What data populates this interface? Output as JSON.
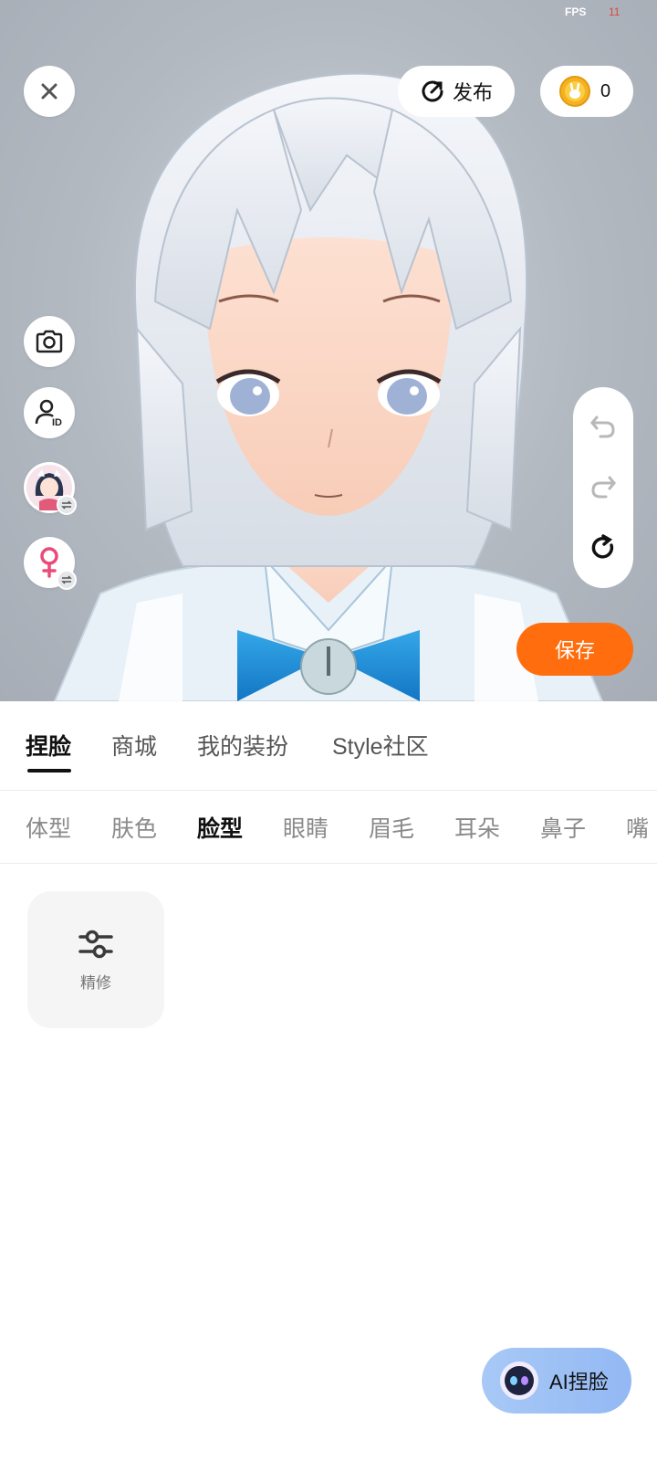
{
  "status": {
    "fps_label": "FPS",
    "fps_value": "11"
  },
  "top_bar": {
    "close_icon": "close-icon",
    "publish_label": "发布",
    "coin_count": "0"
  },
  "side_tools": [
    "camera-icon",
    "avatar-id-icon",
    "character-swap",
    "gender-female-icon"
  ],
  "undo_panel": [
    "undo-icon",
    "redo-icon",
    "reset-icon"
  ],
  "save_label": "保存",
  "main_tabs": [
    {
      "label": "捏脸",
      "active": true
    },
    {
      "label": "商城"
    },
    {
      "label": "我的装扮"
    },
    {
      "label": "Style社区"
    }
  ],
  "sub_tabs": [
    {
      "label": "体型"
    },
    {
      "label": "肤色"
    },
    {
      "label": "脸型",
      "active": true
    },
    {
      "label": "眼睛"
    },
    {
      "label": "眉毛"
    },
    {
      "label": "耳朵"
    },
    {
      "label": "鼻子"
    },
    {
      "label": "嘴"
    }
  ],
  "options": [
    {
      "label": "精修",
      "icon": "sliders-icon"
    }
  ],
  "ai_button": {
    "label": "AI捏脸"
  },
  "colors": {
    "accent": "#ff6d0e",
    "ai_gradient": "#a8c9f6",
    "gender_pink": "#e94b7a"
  }
}
